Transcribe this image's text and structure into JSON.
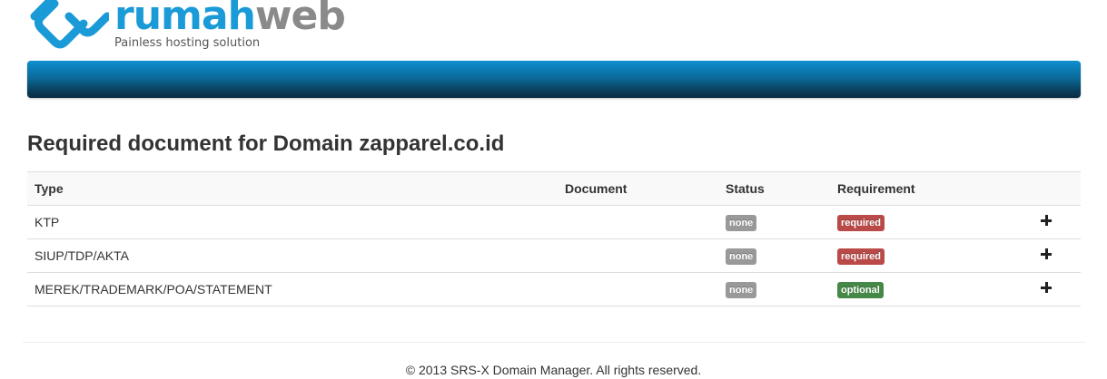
{
  "brand": {
    "name_part1": "rumah",
    "name_part2": "web",
    "tagline": "Painless hosting solution",
    "primary_color": "#1a9ad6",
    "secondary_color": "#8a8a8a"
  },
  "navbar": {
    "gradient_top": "#0e8fce",
    "gradient_bottom": "#082c40"
  },
  "page": {
    "title": "Required document for Domain zapparel.co.id"
  },
  "table": {
    "headers": {
      "type": "Type",
      "document": "Document",
      "status": "Status",
      "requirement": "Requirement"
    },
    "rows": [
      {
        "type": "KTP",
        "document": "",
        "status": "none",
        "requirement": "required",
        "action_icon": "plus-icon"
      },
      {
        "type": "SIUP/TDP/AKTA",
        "document": "",
        "status": "none",
        "requirement": "required",
        "action_icon": "plus-icon"
      },
      {
        "type": "MEREK/TRADEMARK/POA/STATEMENT",
        "document": "",
        "status": "none",
        "requirement": "optional",
        "action_icon": "plus-icon"
      }
    ]
  },
  "badge_colors": {
    "none": "#999999",
    "required": "#b94a48",
    "optional": "#468847"
  },
  "footer": {
    "copyright": "© 2013 SRS-X Domain Manager. All rights reserved."
  }
}
